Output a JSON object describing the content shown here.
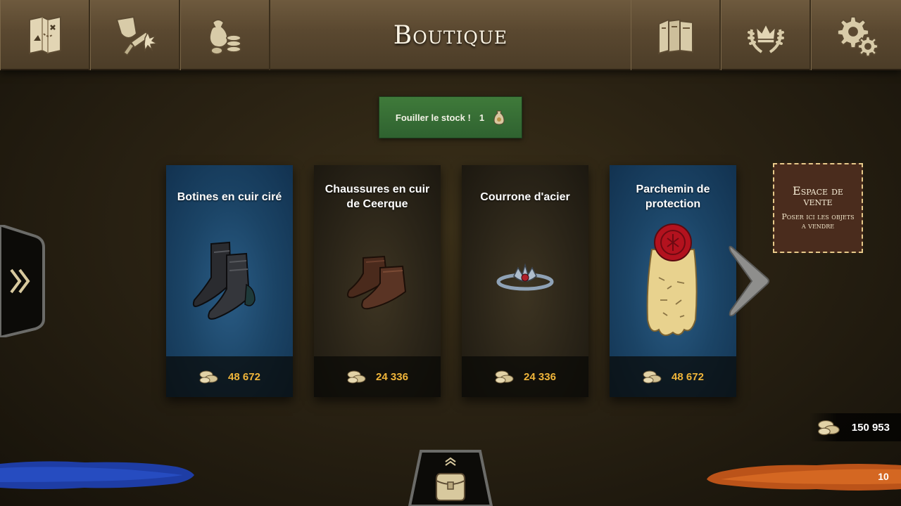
{
  "header": {
    "title": "Boutique",
    "left_buttons": [
      {
        "name": "map-icon"
      },
      {
        "name": "combat-icon"
      },
      {
        "name": "loot-icon"
      }
    ],
    "right_buttons": [
      {
        "name": "codex-icon"
      },
      {
        "name": "ranking-icon"
      },
      {
        "name": "settings-icon"
      }
    ]
  },
  "search": {
    "label": "Fouiller le stock !",
    "cost": "1",
    "icon": "pouch-icon"
  },
  "items": [
    {
      "name": "Botines en cuir ciré",
      "price": "48 672",
      "rarity_color": "#1b4466",
      "icon": "boots-icon"
    },
    {
      "name": "Chaussures en cuir de Ceerque",
      "price": "24 336",
      "rarity_color": "#2a2418",
      "icon": "shoes-icon"
    },
    {
      "name": "Courrone d'acier",
      "price": "24 336",
      "rarity_color": "#2a2418",
      "icon": "crown-ring-icon"
    },
    {
      "name": "Parchemin de protection",
      "price": "48 672",
      "rarity_color": "#1b4466",
      "icon": "scroll-icon"
    }
  ],
  "sell_zone": {
    "title": "Espace de vente",
    "subtitle": "Poser ici les objets a vendre"
  },
  "wallet": {
    "amount": "150 953",
    "icon": "coins-icon"
  },
  "turn": {
    "value": "10"
  },
  "colors": {
    "price": "#f0b53a",
    "team_blue": "#1f3fae",
    "team_orange": "#c4561a",
    "search_button": "#3f7a3a",
    "sell_zone": "#4a2c1d"
  }
}
